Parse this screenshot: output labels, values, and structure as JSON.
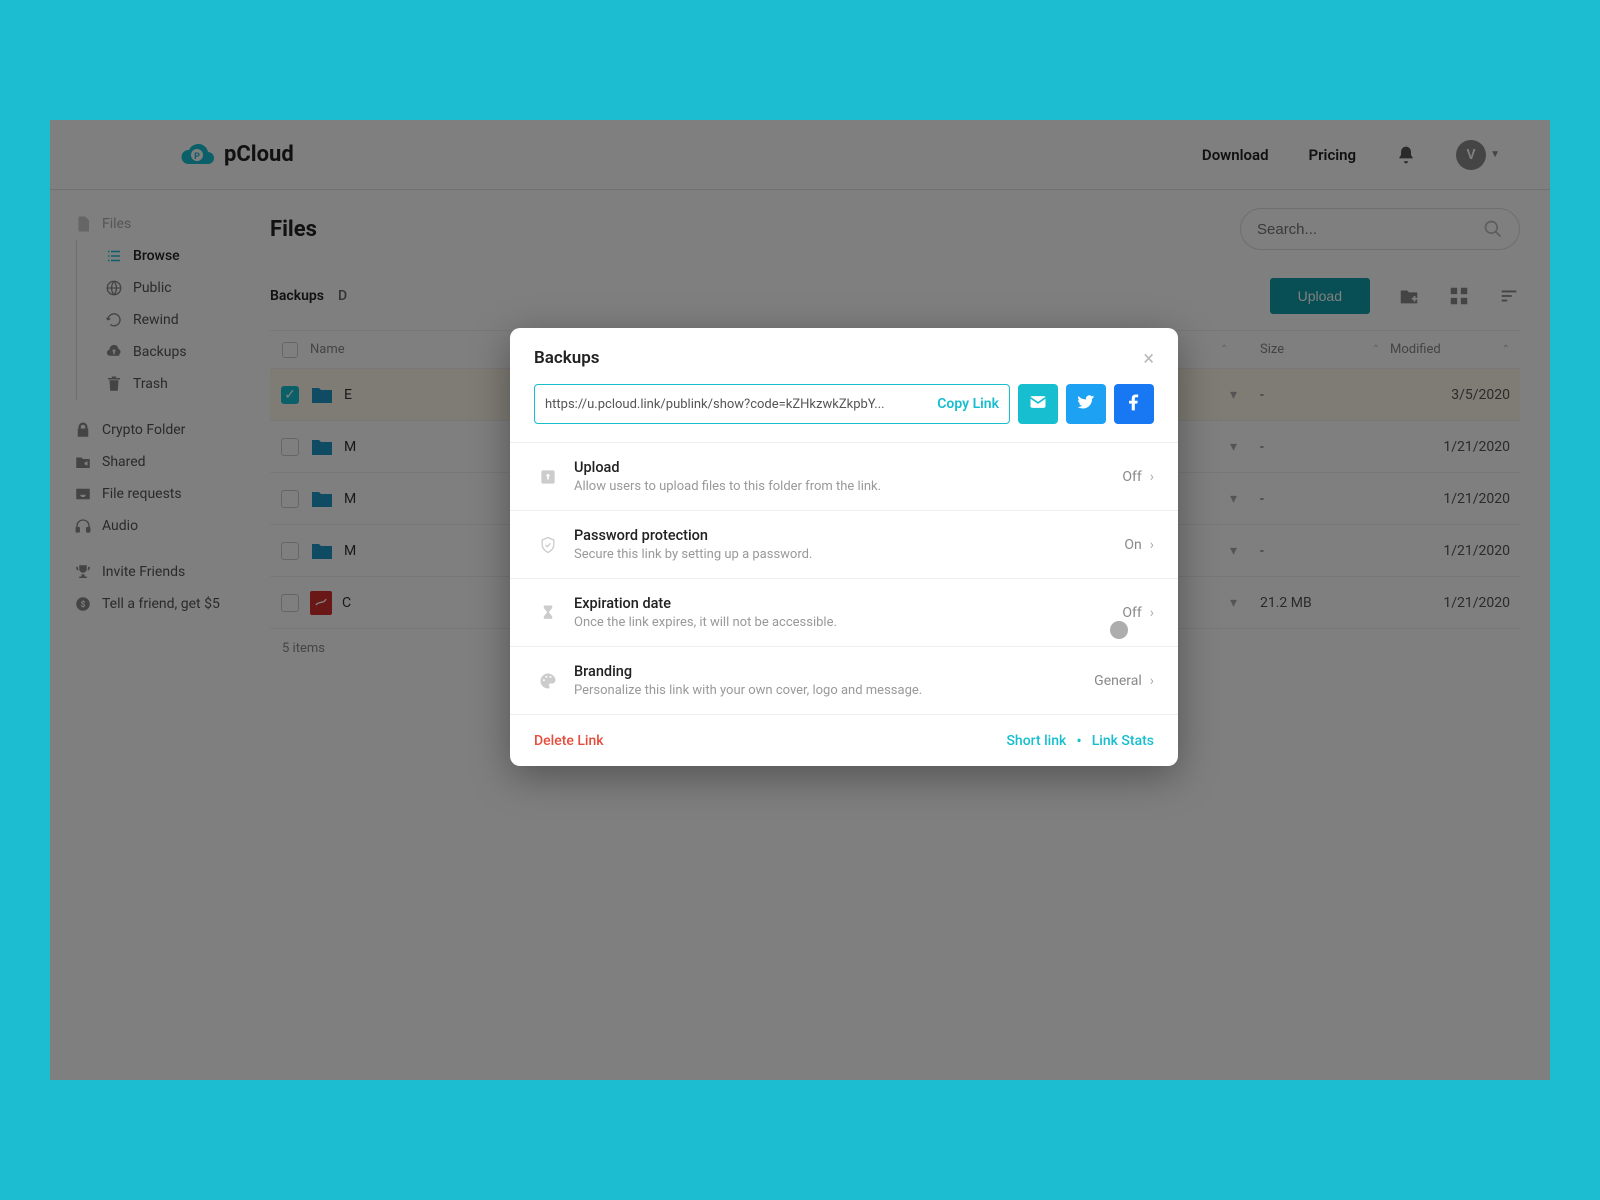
{
  "brand": {
    "name": "pCloud"
  },
  "header": {
    "download": "Download",
    "pricing": "Pricing",
    "avatar_letter": "V"
  },
  "sidebar": {
    "files": "Files",
    "browse": "Browse",
    "public": "Public",
    "rewind": "Rewind",
    "backups": "Backups",
    "trash": "Trash",
    "crypto": "Crypto Folder",
    "shared": "Shared",
    "filereq": "File requests",
    "audio": "Audio",
    "invite": "Invite Friends",
    "tell": "Tell a friend, get $5"
  },
  "page": {
    "title": "Files",
    "search_placeholder": "Search...",
    "upload_btn": "Upload",
    "crumb1": "Backups",
    "crumb2": "D"
  },
  "table": {
    "head_name": "Name",
    "head_size": "Size",
    "head_mod": "Modified",
    "rows": [
      {
        "name": "E",
        "size": "-",
        "modified": "3/5/2020",
        "checked": true
      },
      {
        "name": "M",
        "size": "-",
        "modified": "1/21/2020",
        "checked": false
      },
      {
        "name": "M",
        "size": "-",
        "modified": "1/21/2020",
        "checked": false
      },
      {
        "name": "M",
        "size": "-",
        "modified": "1/21/2020",
        "checked": false
      },
      {
        "name": "C",
        "size": "21.2 MB",
        "modified": "1/21/2020",
        "checked": false,
        "pdf": true
      }
    ],
    "count": "5 items"
  },
  "modal": {
    "title": "Backups",
    "link_url": "https://u.pcloud.link/publink/show?code=kZHkzwkZkpbY...",
    "copy": "Copy Link",
    "settings": [
      {
        "title": "Upload",
        "desc": "Allow users to upload files to this folder from the link.",
        "value": "Off",
        "icon": "upload"
      },
      {
        "title": "Password protection",
        "desc": "Secure this link by setting up a password.",
        "value": "On",
        "icon": "shield"
      },
      {
        "title": "Expiration date",
        "desc": "Once the link expires, it will not be accessible.",
        "value": "Off",
        "icon": "hourglass"
      },
      {
        "title": "Branding",
        "desc": "Personalize this link with your own cover, logo and message.",
        "value": "General",
        "icon": "palette"
      }
    ],
    "delete": "Delete Link",
    "short": "Short link",
    "stats": "Link Stats"
  }
}
